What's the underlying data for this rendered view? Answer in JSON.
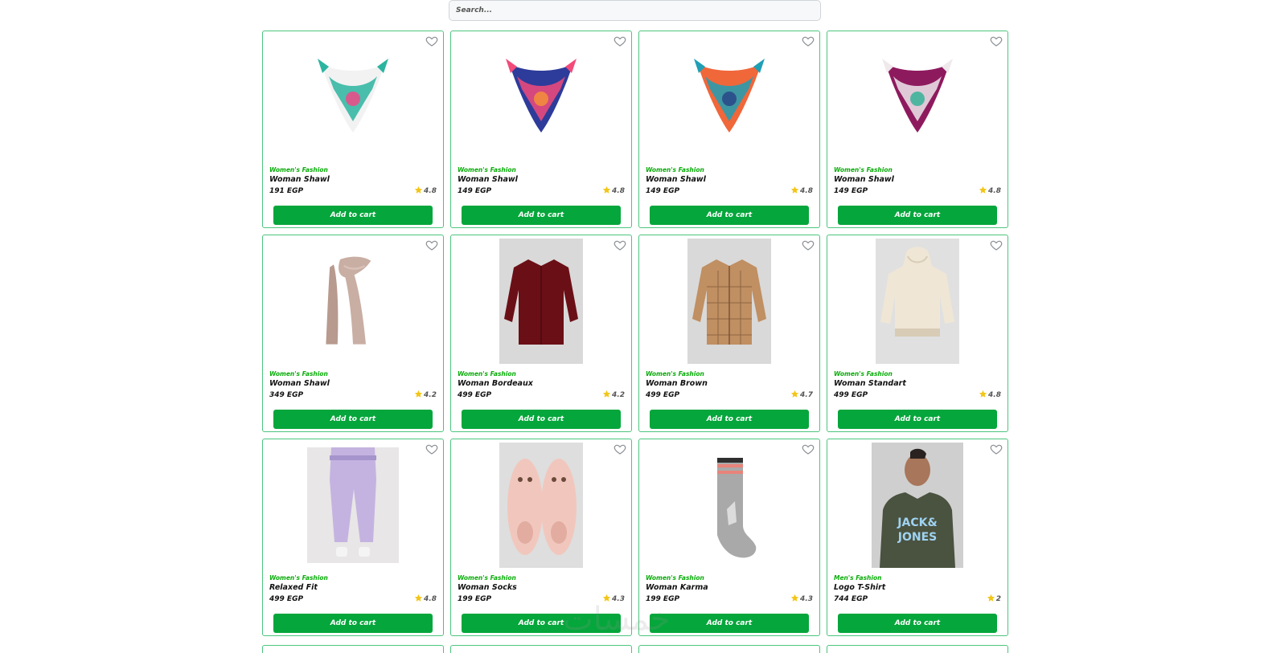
{
  "search": {
    "placeholder": "Search..."
  },
  "products": [
    {
      "category": "Women's Fashion",
      "name": "Woman Shawl",
      "price": "191 EGP",
      "rating": "4.8",
      "button": "Add to cart",
      "image": "scarf-white-teal",
      "colors": [
        "#f2f2f2",
        "#2bb5a0",
        "#e84f8a"
      ]
    },
    {
      "category": "Women's Fashion",
      "name": "Woman Shawl",
      "price": "149 EGP",
      "rating": "4.8",
      "button": "Add to cart",
      "image": "scarf-blue-pink",
      "colors": [
        "#2d3b9a",
        "#f24b7a",
        "#f38b3c"
      ]
    },
    {
      "category": "Women's Fashion",
      "name": "Woman Shawl",
      "price": "149 EGP",
      "rating": "4.8",
      "button": "Add to cart",
      "image": "scarf-orange-teal",
      "colors": [
        "#f0673a",
        "#1f9fb5",
        "#2a4a8a"
      ]
    },
    {
      "category": "Women's Fashion",
      "name": "Woman Shawl",
      "price": "149 EGP",
      "rating": "4.8",
      "button": "Add to cart",
      "image": "scarf-purple-white",
      "colors": [
        "#8e1a5e",
        "#efe9ec",
        "#3fb29b"
      ]
    },
    {
      "category": "Women's Fashion",
      "name": "Woman Shawl",
      "price": "349 EGP",
      "rating": "4.2",
      "button": "Add to cart",
      "image": "long-scarf-beige",
      "colors": [
        "#c9aea3",
        "#b89a8f",
        "#d8c2b8"
      ]
    },
    {
      "category": "Women's Fashion",
      "name": "Woman Bordeaux",
      "price": "499 EGP",
      "rating": "4.2",
      "button": "Add to cart",
      "image": "shirt-bordeaux",
      "colors": [
        "#d9d9d9",
        "#6b0f16",
        "#4a090e"
      ]
    },
    {
      "category": "Women's Fashion",
      "name": "Woman Brown",
      "price": "499 EGP",
      "rating": "4.7",
      "button": "Add to cart",
      "image": "shirt-brown-check",
      "colors": [
        "#d9d9d9",
        "#c08f62",
        "#7a5535"
      ]
    },
    {
      "category": "Women's Fashion",
      "name": "Woman Standart",
      "price": "499 EGP",
      "rating": "4.8",
      "button": "Add to cart",
      "image": "hoodie-cream",
      "colors": [
        "#e0e0e0",
        "#efe6d6",
        "#d8ccb6"
      ]
    },
    {
      "category": "Women's Fashion",
      "name": "Relaxed Fit",
      "price": "499 EGP",
      "rating": "4.8",
      "button": "Add to cart",
      "image": "joggers-lilac",
      "colors": [
        "#e8e6e6",
        "#c4b3e0",
        "#a694cc"
      ]
    },
    {
      "category": "Women's Fashion",
      "name": "Woman Socks",
      "price": "199 EGP",
      "rating": "4.3",
      "button": "Add to cart",
      "image": "slipper-socks-pink",
      "colors": [
        "#dedede",
        "#f1c7bd",
        "#6b4a3a"
      ]
    },
    {
      "category": "Women's Fashion",
      "name": "Woman Karma",
      "price": "199 EGP",
      "rating": "4.3",
      "button": "Add to cart",
      "image": "sock-grey",
      "colors": [
        "#a9a9a9",
        "#e8847a",
        "#2f2f2f"
      ]
    },
    {
      "category": "Men's Fashion",
      "name": "Logo T-Shirt",
      "price": "744 EGP",
      "rating": "2",
      "button": "Add to cart",
      "image": "tshirt-olive-jack-jones",
      "colors": [
        "#cfcfcf",
        "#4a5240",
        "#9fd3f2"
      ]
    }
  ],
  "watermark": "خمسات",
  "colors": {
    "accent": "#05a63b",
    "category": "#0aad0a",
    "border": "#4cc57e",
    "star": "#f3c516"
  }
}
